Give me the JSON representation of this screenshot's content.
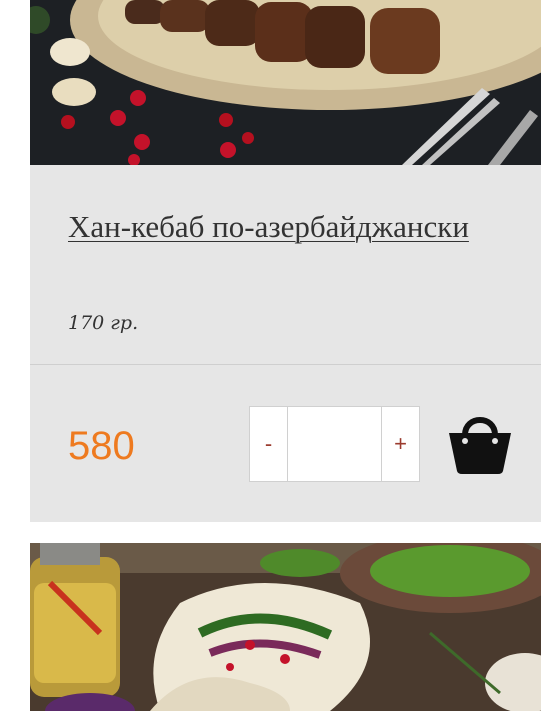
{
  "product": {
    "title": "Хан-кебаб по-азербайджански",
    "weight": "170 гр.",
    "price": "580",
    "quantity": "",
    "minus_label": "-",
    "plus_label": "+"
  },
  "icons": {
    "cart": "shopping-basket-icon"
  },
  "colors": {
    "card_background": "#e6e6e6",
    "price": "#ee7a1f",
    "stepper_symbol": "#9b3b2e",
    "text": "#333333"
  }
}
